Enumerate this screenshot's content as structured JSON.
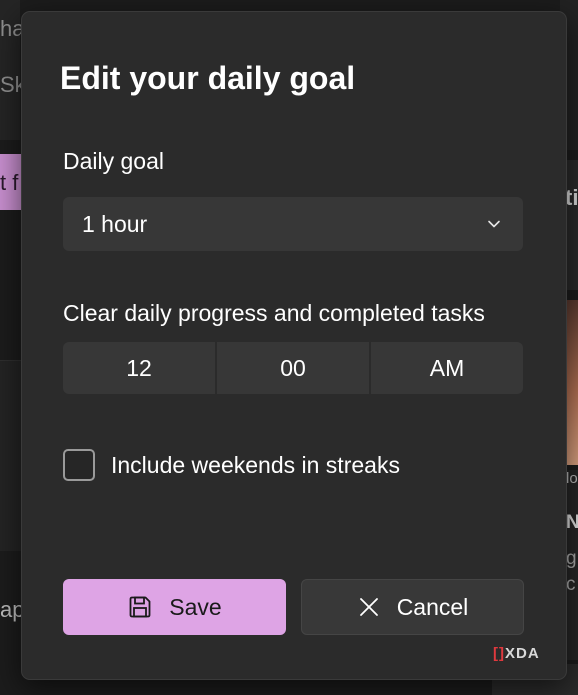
{
  "dialog": {
    "title": "Edit your daily goal",
    "daily_goal_label": "Daily goal",
    "daily_goal_value": "1 hour",
    "clear_label": "Clear daily progress and completed tasks",
    "time": {
      "hour": "12",
      "minute": "00",
      "period": "AM"
    },
    "weekends_label": "Include weekends in streaks",
    "weekends_checked": false,
    "save_label": "Save",
    "cancel_label": "Cancel"
  },
  "background": {
    "left_frag_1": "ha",
    "left_frag_2": "Sk",
    "left_frag_3": "t f",
    "left_frag_4": "ap",
    "right_frag_1": "ti",
    "right_frag_2": "lo",
    "right_frag_3": "N",
    "right_frag_4": "g",
    "right_frag_5": "c"
  },
  "watermark": {
    "brand": "XDA"
  },
  "colors": {
    "accent": "#dea4e5",
    "dialog_bg": "#2b2b2b",
    "control_bg": "#373737"
  }
}
